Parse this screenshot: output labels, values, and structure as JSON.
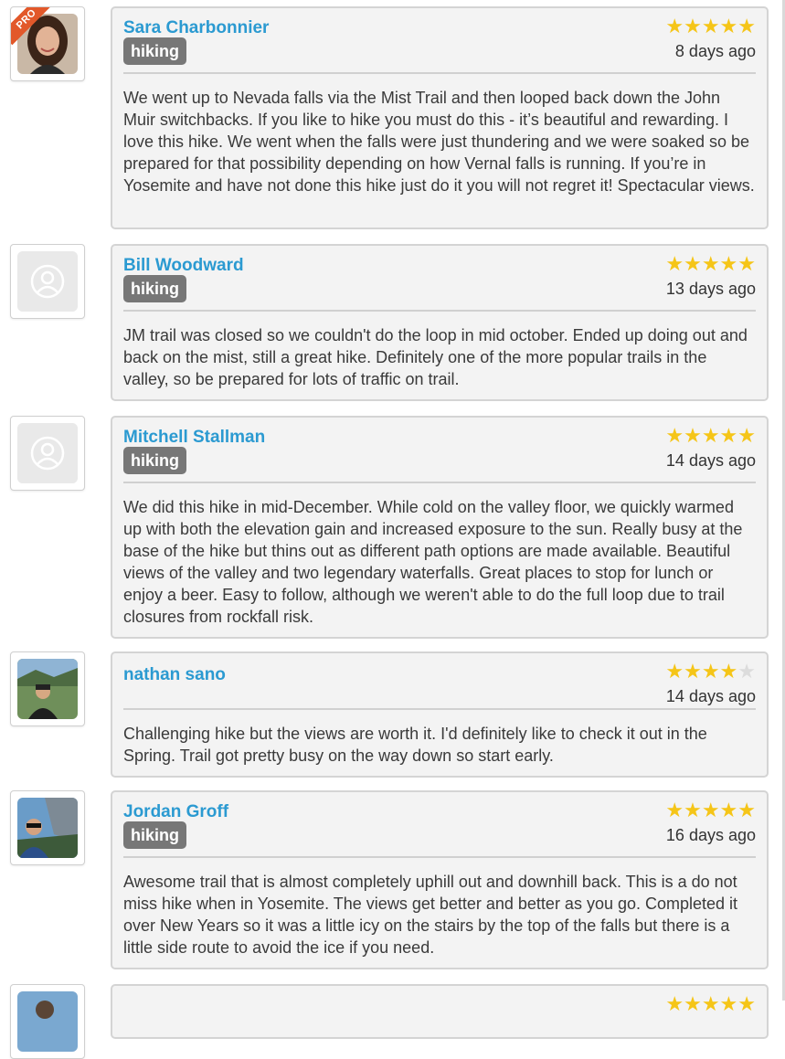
{
  "colors": {
    "link": "#2b9ad1",
    "star": "#f5c518",
    "badge": "#777777",
    "pro": "#e2582a"
  },
  "reviews": [
    {
      "name": "Sara Charbonnier",
      "pro_label": "PRO",
      "badge": "hiking",
      "rating": 5,
      "stars": "★★★★★",
      "stars_off": "",
      "date": "8 days ago",
      "avatar": "photo",
      "text": "We went up to Nevada falls via the Mist Trail and then looped back down the John Muir switchbacks. If you like to hike you must do this - it’s beautiful and rewarding. I love this hike. We went when the falls were just thundering and we were soaked so be prepared for that possibility depending on how Vernal falls is running. If you’re in Yosemite and have not done this hike just do it you will not regret it! Spectacular views."
    },
    {
      "name": "Bill Woodward",
      "badge": "hiking",
      "rating": 5,
      "stars": "★★★★★",
      "stars_off": "",
      "date": "13 days ago",
      "avatar": "default-user-icon",
      "text": "JM trail was closed so we couldn't do the loop in mid october. Ended up doing out and back on the mist, still a great hike. Definitely one of the more popular trails in the valley, so be prepared for lots of traffic on trail."
    },
    {
      "name": "Mitchell Stallman",
      "badge": "hiking",
      "rating": 5,
      "stars": "★★★★★",
      "stars_off": "",
      "date": "14 days ago",
      "avatar": "default-user-icon",
      "text": "We did this hike in mid-December. While cold on the valley floor, we quickly warmed up with both the elevation gain and increased exposure to the sun. Really busy at the base of the hike but thins out as different path options are made available. Beautiful views of the valley and two legendary waterfalls. Great places to stop for lunch or enjoy a beer. Easy to follow, although we weren't able to do the full loop due to trail closures from rockfall risk."
    },
    {
      "name": "nathan sano",
      "badge": "",
      "rating": 4,
      "stars": "★★★★",
      "stars_off": "★",
      "date": "14 days ago",
      "avatar": "photo",
      "text": "Challenging hike but the views are worth it. I'd definitely like to check it out in the Spring. Trail got pretty busy on the way down so start early."
    },
    {
      "name": "Jordan Groff",
      "badge": "hiking",
      "rating": 5,
      "stars": "★★★★★",
      "stars_off": "",
      "date": "16 days ago",
      "avatar": "photo",
      "text": "Awesome trail that is almost completely uphill out and downhill back. This is a do not miss hike when in Yosemite. The views get better and better as you go. Completed it over New Years so it was a little icy on the stairs by the top of the falls but there is a little side route to avoid the ice if you need."
    },
    {
      "name": "",
      "badge": "",
      "rating": 5,
      "stars": "★★★★★",
      "stars_off": "",
      "date": "",
      "avatar": "photo",
      "text": ""
    }
  ]
}
